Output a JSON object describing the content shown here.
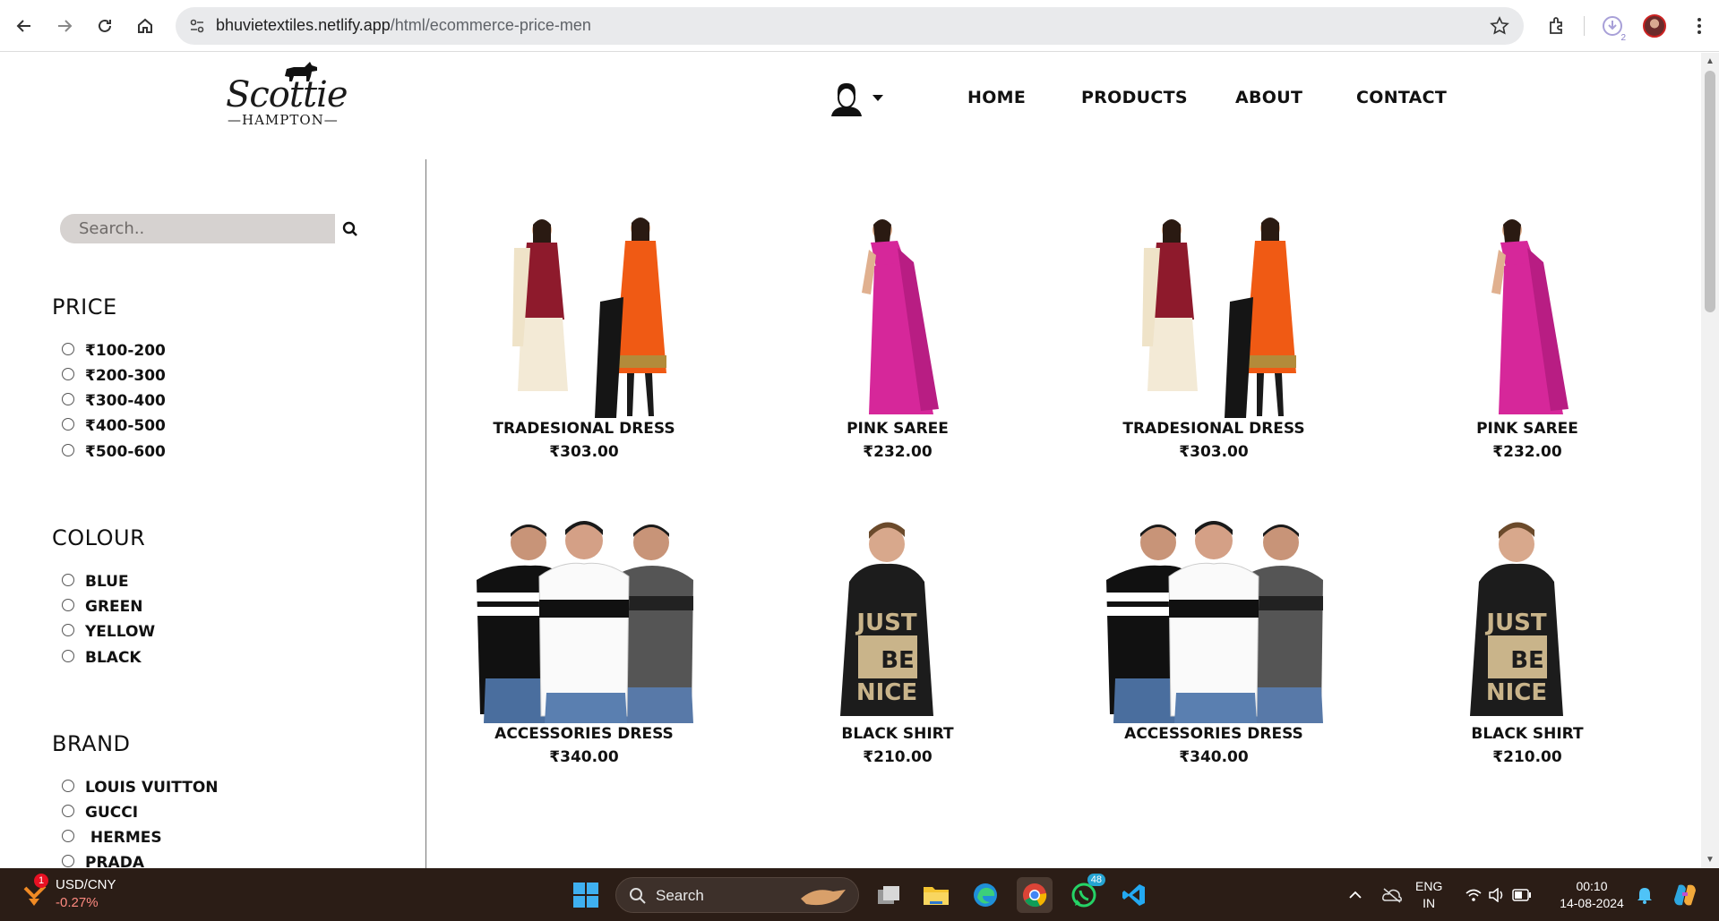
{
  "browser": {
    "url_host": "bhuvietextiles.netlify.app",
    "url_path": "/html/ecommerce-price-men",
    "downloads_badge": "2"
  },
  "site": {
    "logo_script": "Scottie",
    "logo_sub": "—HAMPTON—",
    "nav": {
      "home": "HOME",
      "products": "PRODUCTS",
      "about": "ABOUT",
      "contact": "CONTACT"
    }
  },
  "sidebar": {
    "search_placeholder": "Search..",
    "price": {
      "title": "PRICE",
      "options": [
        "₹100-200",
        "₹200-300",
        "₹300-400",
        "₹400-500",
        "₹500-600"
      ]
    },
    "colour": {
      "title": "COLOUR",
      "options": [
        "BLUE",
        "GREEN",
        "YELLOW",
        "BLACK"
      ]
    },
    "brand": {
      "title": "BRAND",
      "options": [
        "LOUIS VUITTON",
        "GUCCI",
        " HERMES",
        "PRADA"
      ]
    }
  },
  "products": [
    {
      "name": "TRADESIONAL DRESS",
      "price": "₹303.00",
      "image": "salwar-suits-pair"
    },
    {
      "name": "PINK SAREE",
      "price": "₹232.00",
      "image": "pink-saree"
    },
    {
      "name": "TRADESIONAL DRESS",
      "price": "₹303.00",
      "image": "salwar-suits-pair"
    },
    {
      "name": "PINK SAREE",
      "price": "₹232.00",
      "image": "pink-saree"
    },
    {
      "name": "ACCESSORIES DRESS",
      "price": "₹340.00",
      "image": "three-men-tshirts"
    },
    {
      "name": "BLACK SHIRT",
      "price": "₹210.00",
      "image": "black-hoodie"
    },
    {
      "name": "ACCESSORIES DRESS",
      "price": "₹340.00",
      "image": "three-men-tshirts"
    },
    {
      "name": "BLACK SHIRT",
      "price": "₹210.00",
      "image": "black-hoodie"
    }
  ],
  "hoodie_print": [
    "JUST",
    "BE",
    "NICE"
  ],
  "taskbar": {
    "ticker_symbol": "USD/CNY",
    "ticker_change": "-0.27%",
    "ticker_badge": "1",
    "search_label": "Search",
    "whatsapp_badge": "48",
    "lang_top": "ENG",
    "lang_bottom": "IN",
    "time": "00:10",
    "date": "14-08-2024"
  },
  "colors": {
    "taskbar_bg": "#2b1d16",
    "saree_pink": "#d6279a",
    "suit_orange": "#f05a14",
    "suit_maroon": "#8e1a2c"
  }
}
